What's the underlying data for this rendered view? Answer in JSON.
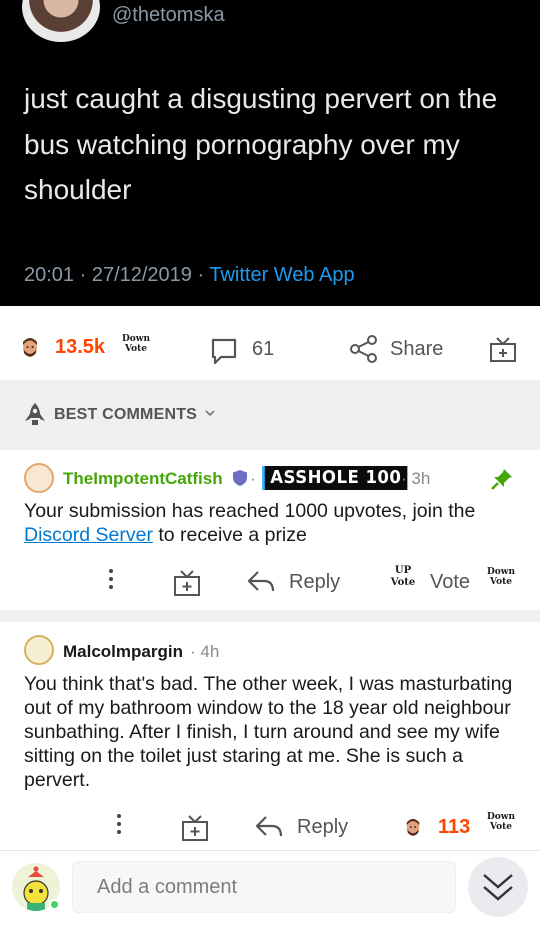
{
  "tweet": {
    "handle": "@thetomska",
    "text": "just caught a disgusting pervert on the bus watching pornography over my shoulder",
    "timestamp": "20:01 · 27/12/2019 · ",
    "source": "Twitter Web App"
  },
  "post_actions": {
    "score": "13.5k",
    "downvote_label_line1": "Down",
    "downvote_label_line2": "Vote",
    "comment_count": "61",
    "share_label": "Share"
  },
  "sort": {
    "label": "BEST COMMENTS"
  },
  "comments": [
    {
      "author": "TheImpotentCatfish",
      "flair": "ASSHOLE 100",
      "time": "3h",
      "body_before_link": "Your submission has reached 1000 upvotes, join the ",
      "link_text": "Discord Server",
      "body_after_link": " to receive a prize",
      "reply_label": "Reply",
      "upvote_line1": "UP",
      "upvote_line2": "Vote",
      "vote_label": "Vote",
      "downvote_line1": "Down",
      "downvote_line2": "Vote"
    },
    {
      "author": "Malcolmpargin",
      "time": "4h",
      "body": "You think that's bad. The other week, I was masturbating out of my bathroom window to the 18 year old neighbour sunbathing. After I finish, I turn around and see my wife sitting on the toilet just staring at me. She is such a pervert.",
      "reply_label": "Reply",
      "score": "113",
      "downvote_line1": "Down",
      "downvote_line2": "Vote"
    }
  ],
  "bottom_bar": {
    "add_comment_placeholder": "Add a comment"
  },
  "colors": {
    "accent_orange": "#ff4500",
    "mod_green": "#46a508",
    "link_blue": "#0079d3",
    "twitter_blue": "#1d9bf0"
  },
  "icons": [
    "comment-icon",
    "share-icon",
    "award-gift-icon",
    "mod-shield-icon",
    "pin-icon",
    "more-dots-icon",
    "reply-arrow-icon",
    "chevron-down-icon",
    "collapse-chevrons-icon"
  ]
}
